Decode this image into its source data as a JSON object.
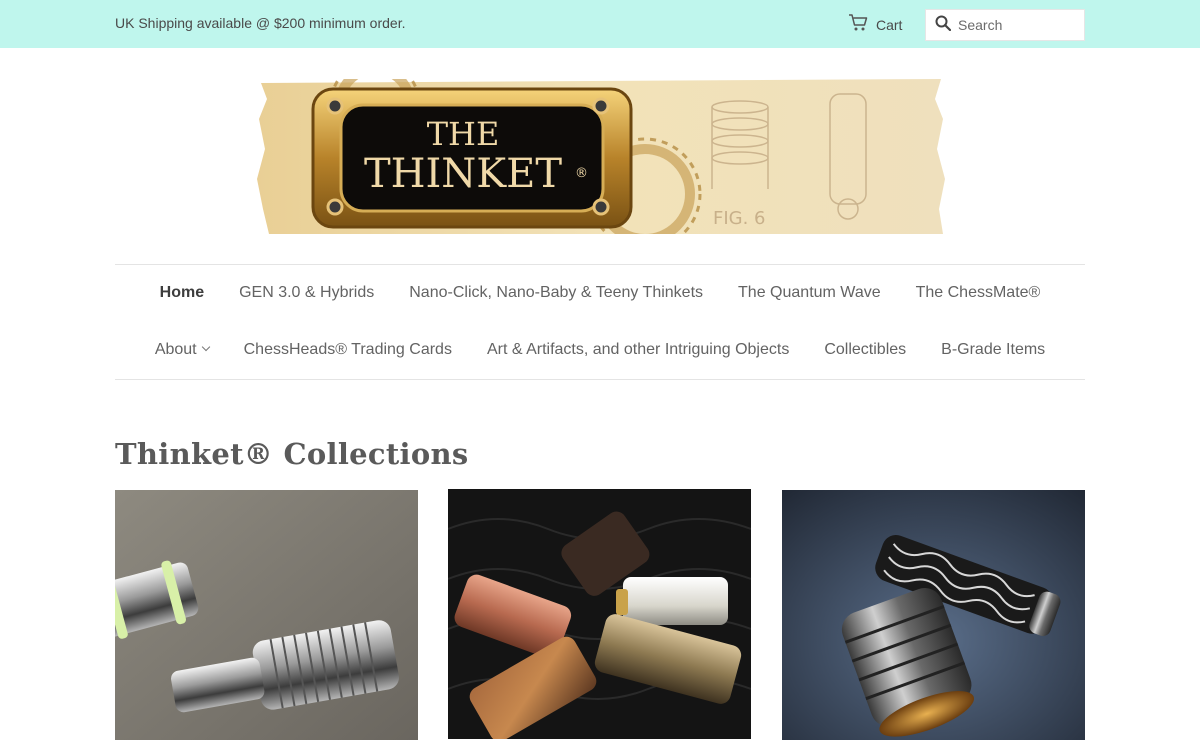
{
  "announcement": {
    "text": "UK Shipping available @ $200 minimum order."
  },
  "header": {
    "cart_label": "Cart",
    "search_placeholder": "Search"
  },
  "logo": {
    "line1": "THE",
    "line2": "THINKET",
    "mark": "®",
    "fig_label": "FIG. 6"
  },
  "nav": {
    "row1": [
      {
        "label": "Home",
        "active": true
      },
      {
        "label": "GEN 3.0 & Hybrids"
      },
      {
        "label": "Nano-Click, Nano-Baby & Teeny Thinkets"
      },
      {
        "label": "The Quantum Wave"
      },
      {
        "label": "The ChessMate®"
      }
    ],
    "row2": [
      {
        "label": "About",
        "dropdown": true
      },
      {
        "label": "ChessHeads® Trading Cards"
      },
      {
        "label": "Art & Artifacts, and other Intriguing Objects"
      },
      {
        "label": "Collectibles"
      },
      {
        "label": "B-Grade Items"
      }
    ]
  },
  "collections": {
    "title": "Thinket® Collections"
  },
  "colors": {
    "announce_bg": "#bff6ed",
    "text": "#636363",
    "rule": "#e4e4e4"
  }
}
